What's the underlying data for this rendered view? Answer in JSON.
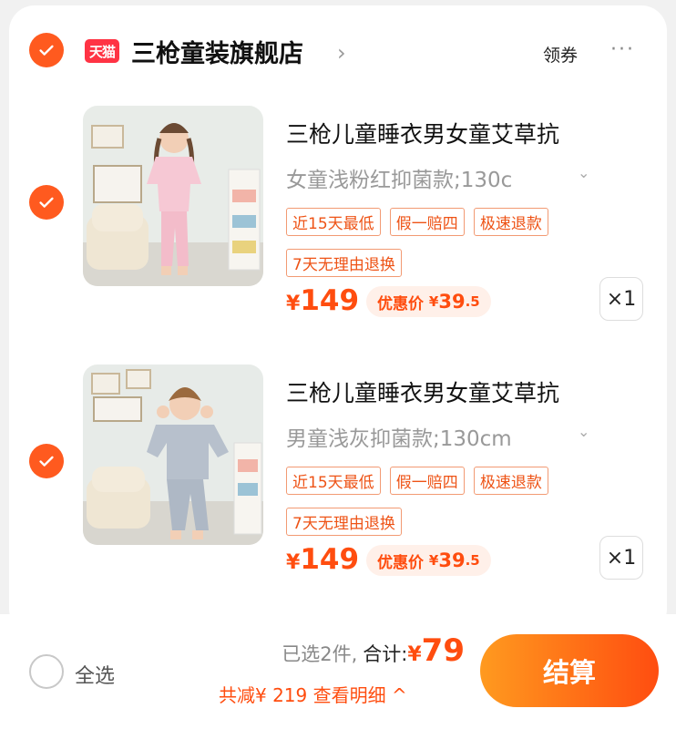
{
  "colors": {
    "accent": "#ff5a1f",
    "price": "#ff4d0f",
    "tag_border": "#f29a73",
    "promo_bg": "#fff0e9",
    "tmall_red": "#ff3344"
  },
  "store": {
    "logo_text": "天猫",
    "name": "三枪童装旗舰店",
    "chevron": "›",
    "coupon_label": "领券",
    "more_label": "···",
    "checked": true
  },
  "items": [
    {
      "checked": true,
      "image_icon": "product-photo-girl-pink-pajamas",
      "title": "三枪儿童睡衣男女童艾草抗",
      "sku": "女童浅粉红抑菌款;130c",
      "sku_arrow": "⌄",
      "tags": [
        "近15天最低",
        "假一赔四",
        "极速退款",
        "7天无理由退换"
      ],
      "price_symbol": "¥",
      "price": "149",
      "promo_label": "优惠价",
      "promo_symbol": "¥",
      "promo_int": "39",
      "promo_dec": ".5",
      "quantity": "×1"
    },
    {
      "checked": true,
      "image_icon": "product-photo-boy-grey-pajamas",
      "title": "三枪儿童睡衣男女童艾草抗",
      "sku": "男童浅灰抑菌款;130cm",
      "sku_arrow": "⌄",
      "tags": [
        "近15天最低",
        "假一赔四",
        "极速退款",
        "7天无理由退换"
      ],
      "price_symbol": "¥",
      "price": "149",
      "promo_label": "优惠价",
      "promo_symbol": "¥",
      "promo_int": "39",
      "promo_dec": ".5",
      "quantity": "×1"
    }
  ],
  "footer": {
    "select_all_label": "全选",
    "select_all_checked": false,
    "selected_count": "已选2件,",
    "total_label": "合计:",
    "total_symbol": "¥",
    "total_value": "79",
    "discount_text": "共减¥ 219 查看明细 ^",
    "checkout_label": "结算"
  }
}
